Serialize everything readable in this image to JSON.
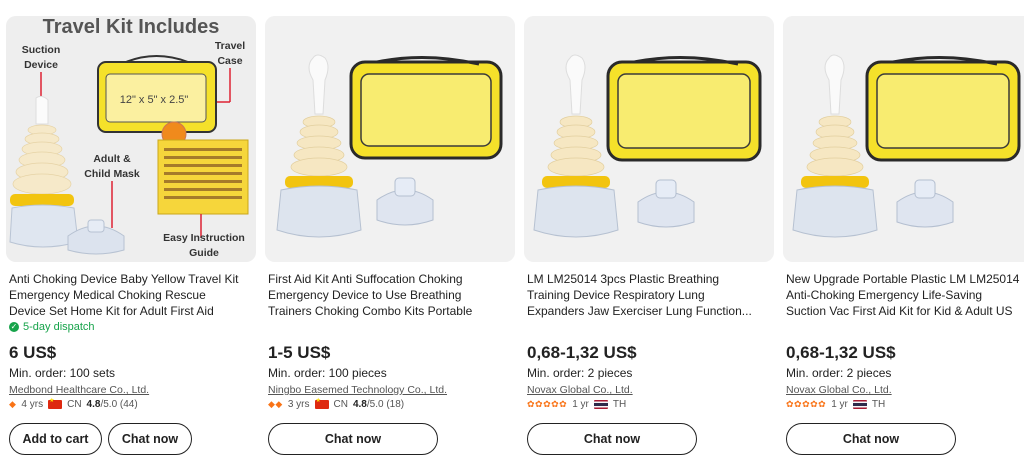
{
  "products": [
    {
      "image_overlay": {
        "heading": "Travel Kit Includes",
        "suction_label_1": "Suction",
        "suction_label_2": "Device",
        "case_label_1": "Travel",
        "case_label_2": "Case",
        "dimensions": "12\" x 5\" x 2.5\"",
        "mask_label_1": "Adult &",
        "mask_label_2": "Child Mask",
        "guide_label_1": "Easy Instruction",
        "guide_label_2": "Guide"
      },
      "title_lines": [
        "Anti Choking Device Baby Yellow Travel Kit",
        "Emergency Medical Choking Rescue",
        "Device Set Home Kit for Adult First Aid"
      ],
      "dispatch": "5-day dispatch",
      "price": "6 US$",
      "min_order": "Min. order: 100 sets",
      "supplier": "Medbond Healthcare Co., Ltd.",
      "medals": "◆",
      "years": "4 yrs",
      "country": "CN",
      "rating_value": "4.8",
      "rating_suffix": "/5.0 (44)",
      "buttons": {
        "cart": "Add to cart",
        "chat": "Chat now"
      }
    },
    {
      "title_lines": [
        "First Aid Kit Anti Suffocation Choking",
        "Emergency Device to Use Breathing",
        "Trainers Choking Combo Kits Portable"
      ],
      "price": "1-5 US$",
      "min_order": "Min. order: 100 pieces",
      "supplier": "Ningbo Easemed Technology Co., Ltd.",
      "medals": "◆◆",
      "years": "3 yrs",
      "country": "CN",
      "rating_value": "4.8",
      "rating_suffix": "/5.0 (18)",
      "buttons": {
        "chat": "Chat now"
      }
    },
    {
      "title_lines": [
        "LM LM25014 3pcs Plastic Breathing",
        "Training Device Respiratory Lung",
        "Expanders Jaw Exerciser Lung Function..."
      ],
      "price": "0,68-1,32 US$",
      "min_order": "Min. order: 2 pieces",
      "supplier": "Novax Global Co., Ltd.",
      "medals": "✿✿✿✿✿",
      "years": "1 yr",
      "country": "TH",
      "buttons": {
        "chat": "Chat now"
      }
    },
    {
      "title_lines": [
        "New Upgrade Portable Plastic LM LM25014",
        "Anti-Choking Emergency Life-Saving",
        "Suction Vac First Aid Kit for Kid & Adult US"
      ],
      "price": "0,68-1,32 US$",
      "min_order": "Min. order: 2 pieces",
      "supplier": "Novax Global Co., Ltd.",
      "medals": "✿✿✿✿✿",
      "years": "1 yr",
      "country": "TH",
      "buttons": {
        "chat": "Chat now"
      }
    }
  ],
  "colors": {
    "accent_green": "#16a34a",
    "medal_orange": "#f97316",
    "case_yellow": "#f5e12a",
    "ring_yellow": "#f2c40f"
  }
}
